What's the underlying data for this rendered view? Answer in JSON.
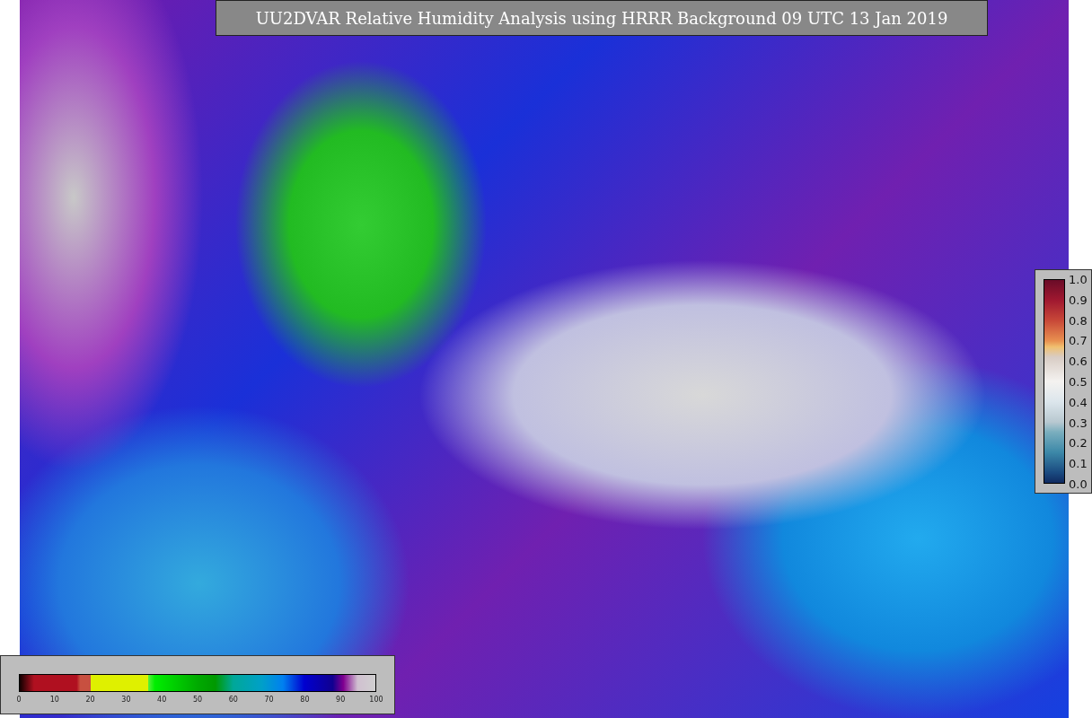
{
  "title": "UU2DVAR Relative Humidity Analysis using HRRR Background 09 UTC 13 Jan 2019",
  "humidity_colorbar": {
    "ticks": [
      "0",
      "10",
      "20",
      "30",
      "40",
      "50",
      "60",
      "70",
      "80",
      "90",
      "100"
    ]
  },
  "observation_colorbar": {
    "ticks": [
      "1.0",
      "0.9",
      "0.8",
      "0.7",
      "0.6",
      "0.5",
      "0.4",
      "0.3",
      "0.2",
      "0.1",
      "0.0"
    ]
  }
}
